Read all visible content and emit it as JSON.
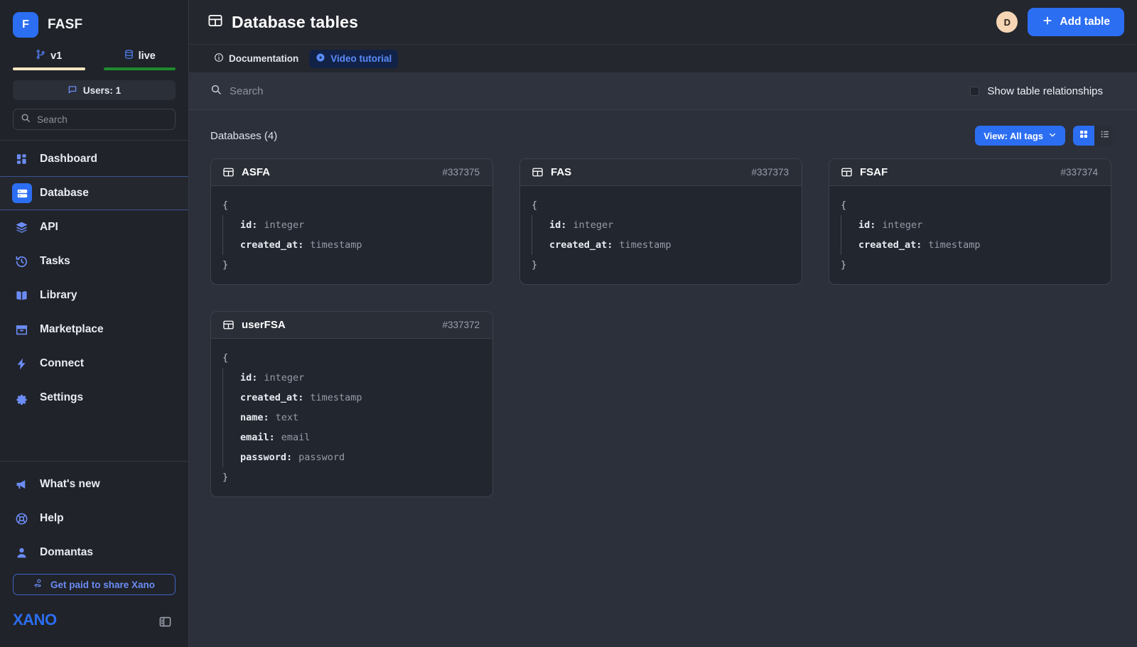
{
  "sidebar": {
    "brand": {
      "initial": "F",
      "name": "FASF"
    },
    "env_tabs": [
      {
        "label": "v1",
        "icon": "branch-icon",
        "underline_color": "#f4e6c0"
      },
      {
        "label": "live",
        "icon": "database-icon",
        "underline_color": "#1d8a2c"
      }
    ],
    "users_pill": {
      "label": "Users: 1",
      "icon": "chat-icon"
    },
    "search": {
      "placeholder": "Search",
      "icon": "search-icon"
    },
    "nav_items": [
      {
        "label": "Dashboard",
        "icon": "dashboard-icon",
        "active": false
      },
      {
        "label": "Database",
        "icon": "database-icon",
        "active": true
      },
      {
        "label": "API",
        "icon": "layers-icon",
        "active": false
      },
      {
        "label": "Tasks",
        "icon": "history-icon",
        "active": false
      },
      {
        "label": "Library",
        "icon": "book-icon",
        "active": false
      },
      {
        "label": "Marketplace",
        "icon": "store-icon",
        "active": false
      },
      {
        "label": "Connect",
        "icon": "bolt-icon",
        "active": false
      },
      {
        "label": "Settings",
        "icon": "gear-icon",
        "active": false
      }
    ],
    "bottom_items": [
      {
        "label": "What's new",
        "icon": "megaphone-icon"
      },
      {
        "label": "Help",
        "icon": "lifebuoy-icon"
      },
      {
        "label": "Domantas",
        "icon": "user-icon"
      }
    ],
    "share_button": {
      "label": "Get paid to share Xano",
      "icon": "hand-coin-icon"
    },
    "logo_text": "XANO",
    "collapse_icon": "panel-collapse-icon"
  },
  "header": {
    "title": "Database tables",
    "title_icon": "table-icon",
    "avatar_initial": "D",
    "add_button": {
      "label": "Add table",
      "icon": "plus-icon"
    },
    "accent_color": "#2c6ef2"
  },
  "doc_row": {
    "chips": [
      {
        "label": "Documentation",
        "icon": "info-icon",
        "highlight": false
      },
      {
        "label": "Video tutorial",
        "icon": "play-icon",
        "highlight": true
      }
    ]
  },
  "search_row": {
    "placeholder": "Search",
    "icon": "search-icon",
    "relationships_label": "Show table relationships",
    "relationships_checked": false
  },
  "section": {
    "title": "Databases (4)",
    "view_button": {
      "label": "View: All tags",
      "icon": "chevron-down-icon"
    },
    "view_toggles": [
      {
        "icon": "grid-view-icon",
        "active": true
      },
      {
        "icon": "list-view-icon",
        "active": false
      }
    ]
  },
  "tables": [
    {
      "name": "ASFA",
      "id": "#337375",
      "icon": "table-icon",
      "fields": [
        {
          "key": "id:",
          "type": "integer"
        },
        {
          "key": "created_at:",
          "type": "timestamp"
        }
      ]
    },
    {
      "name": "FAS",
      "id": "#337373",
      "icon": "table-icon",
      "fields": [
        {
          "key": "id:",
          "type": "integer"
        },
        {
          "key": "created_at:",
          "type": "timestamp"
        }
      ]
    },
    {
      "name": "FSAF",
      "id": "#337374",
      "icon": "table-icon",
      "fields": [
        {
          "key": "id:",
          "type": "integer"
        },
        {
          "key": "created_at:",
          "type": "timestamp"
        }
      ]
    },
    {
      "name": "userFSA",
      "id": "#337372",
      "icon": "table-icon",
      "fields": [
        {
          "key": "id:",
          "type": "integer"
        },
        {
          "key": "created_at:",
          "type": "timestamp"
        },
        {
          "key": "name:",
          "type": "text"
        },
        {
          "key": "email:",
          "type": "email"
        },
        {
          "key": "password:",
          "type": "password"
        }
      ]
    }
  ],
  "brace_open": "{",
  "brace_close": "}"
}
